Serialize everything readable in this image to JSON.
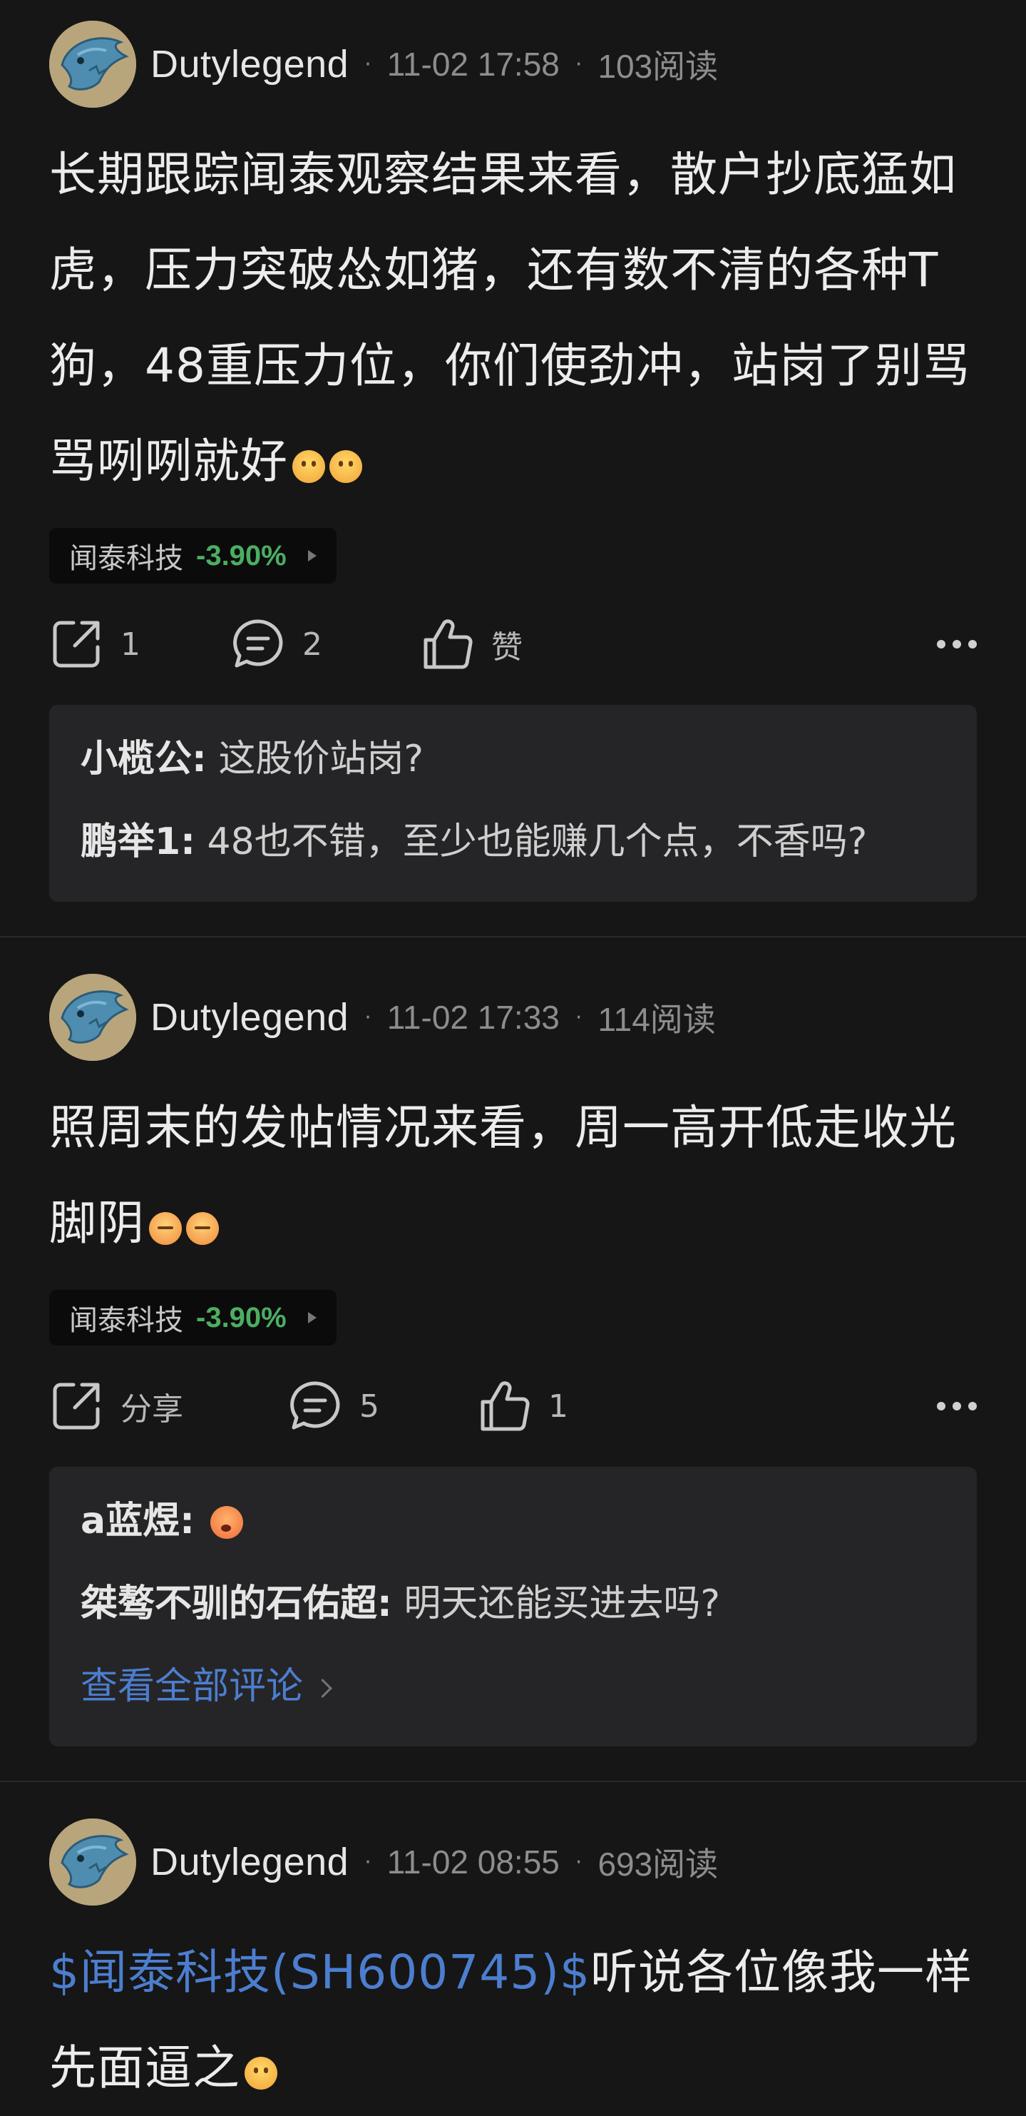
{
  "posts": [
    {
      "author": "Dutylegend",
      "time": "11-02 17:58",
      "reads": "103阅读",
      "content": "长期跟踪闻泰观察结果来看，散户抄底猛如虎，压力突破怂如猪，还有数不清的各种T狗，48重压力位，你们使劲冲，站岗了别骂骂咧咧就好",
      "emoji_icons": [
        "smiling-face-emoji",
        "smiling-face-emoji"
      ],
      "stock": {
        "name": "闻泰科技",
        "change": "-3.90%",
        "change_color": "#4cae62"
      },
      "actions": {
        "share": "1",
        "comment": "2",
        "like": "赞"
      },
      "comments": [
        {
          "name": "小榄公:",
          "text": "这股价站岗?"
        },
        {
          "name": "鹏举1:",
          "text": "48也不错，至少也能赚几个点，不香吗?"
        }
      ]
    },
    {
      "author": "Dutylegend",
      "time": "11-02 17:33",
      "reads": "114阅读",
      "content": "照周末的发帖情况来看，周一高开低走收光脚阴",
      "emoji_icons": [
        "sleepy-face-emoji",
        "sleepy-face-emoji"
      ],
      "stock": {
        "name": "闻泰科技",
        "change": "-3.90%",
        "change_color": "#4cae62"
      },
      "actions": {
        "share": "分享",
        "comment": "5",
        "like": "1"
      },
      "comments": [
        {
          "name": "a蓝煜:",
          "text": ""
        },
        {
          "name": "桀骜不驯的石佑超:",
          "text": "明天还能买进去吗?"
        }
      ],
      "view_all": "查看全部评论"
    },
    {
      "author": "Dutylegend",
      "time": "11-02 08:55",
      "reads": "693阅读",
      "content_link": "$闻泰科技(SH600745)$",
      "content": "听说各位像我一样先面逼之"
    }
  ],
  "colors": {
    "background": "#161616",
    "link": "#4c7ecf",
    "down": "#4cae62"
  }
}
